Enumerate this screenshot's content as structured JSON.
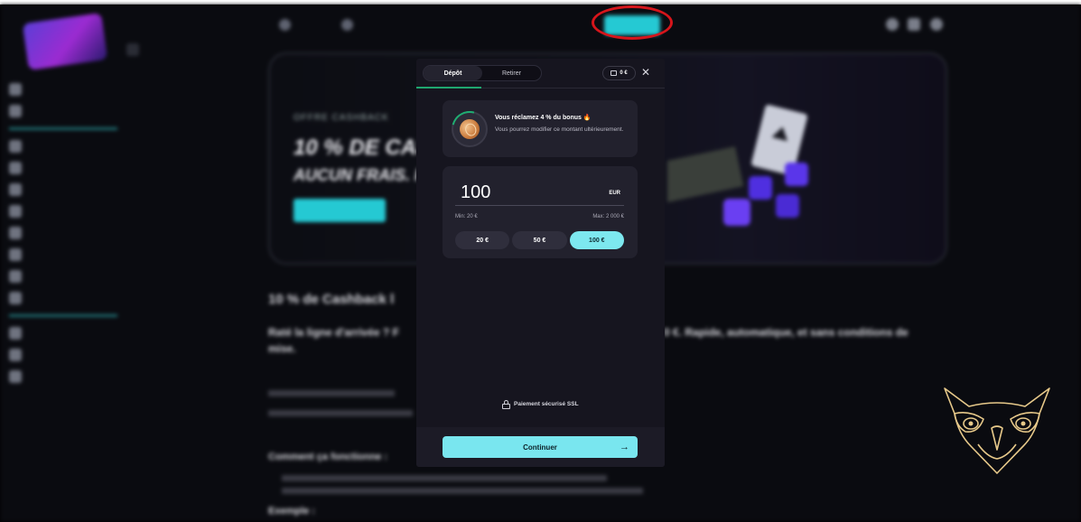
{
  "modal": {
    "tabs": [
      {
        "label": "Dépôt",
        "active": true
      },
      {
        "label": "Retirer",
        "active": false
      }
    ],
    "balance_chip": "0 €",
    "close_icon": "close-icon",
    "bonus": {
      "title": "Vous réclamez 4 % du bonus 🔥",
      "subtitle": "Vous pourrez modifier ce montant ultérieurement."
    },
    "amount": {
      "value": "100",
      "currency": "EUR",
      "min_label": "Min: 20 €",
      "max_label": "Max: 2 000 €",
      "presets": [
        {
          "label": "20 €",
          "active": false
        },
        {
          "label": "50 €",
          "active": false
        },
        {
          "label": "100 €",
          "active": true
        }
      ]
    },
    "ssl_label": "Paiement sécurisé SSL",
    "continue_label": "Continuer"
  },
  "background": {
    "banner_eyebrow": "OFFRE CASHBACK",
    "banner_headline": "10 % DE CAS",
    "banner_subline": "AUCUN FRAIS. R",
    "section_title": "10 % de Cashback l",
    "paragraph_start": "Raté la ligne d'arrivée ? F",
    "paragraph_end": "0 €. Rapide, automatique, et sans conditions de",
    "paragraph_line2": "mise.",
    "how_title": "Comment ça fonctionne :",
    "example_title": "Exemple :"
  },
  "colors": {
    "accent": "#79e6ef",
    "highlight_ring": "#d6151b",
    "modal_bg": "#16151f",
    "card_bg": "#22212d",
    "tab_progress": "#1fa66f"
  }
}
